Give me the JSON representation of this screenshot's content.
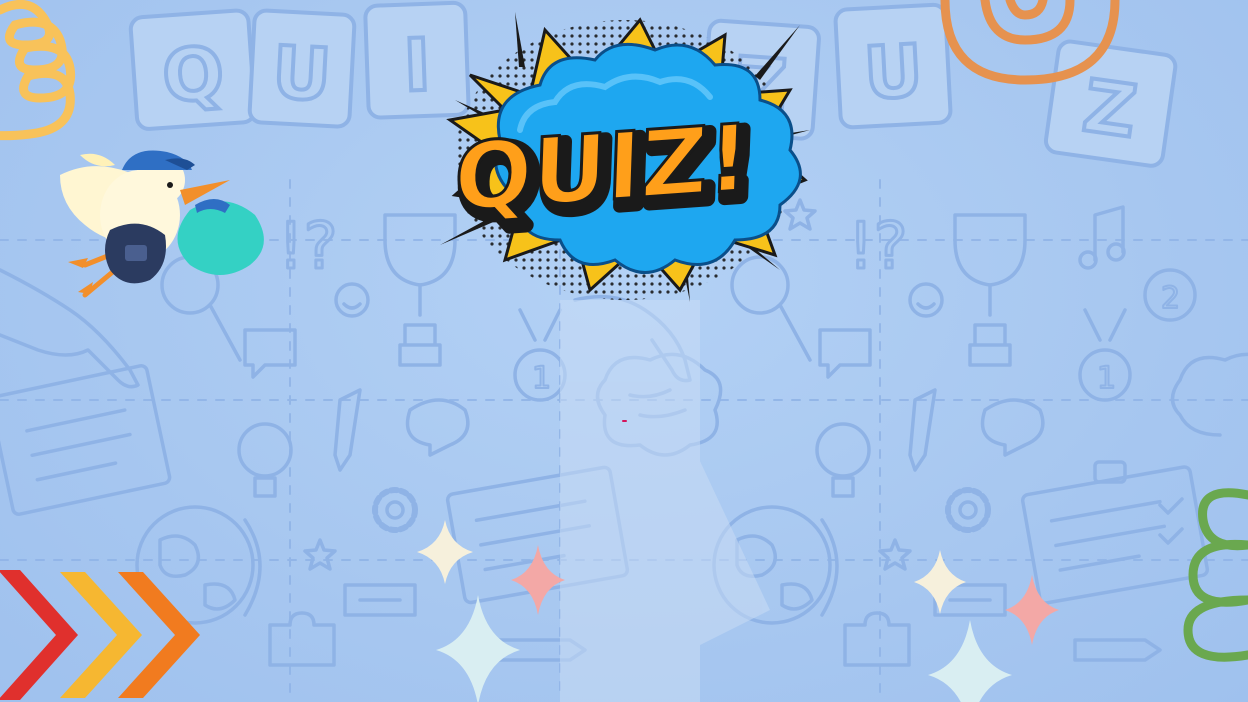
{
  "scene": {
    "title": "QUIZ!",
    "background_letters": [
      "Q",
      "U",
      "I",
      "Z",
      "U",
      "Z"
    ],
    "colors": {
      "background": "#a9c9f1",
      "doodle": "#8fb3e6",
      "burst_yellow": "#f7c21a",
      "cloud_blue": "#1ea7f0",
      "title_orange": "#ff9f1a",
      "title_outline": "#1a1a1a",
      "chevron_red": "#e0302d",
      "chevron_yellow": "#f6b731",
      "chevron_orange": "#f17b1f",
      "swirl_orange": "#e6924f",
      "spring_yellow": "#f8c25a",
      "spring_green": "#6aa84f",
      "sparkle_pink": "#f3a8a6",
      "sparkle_cream": "#f6f0dc",
      "sparkle_mint": "#d9eef2"
    },
    "icons": [
      "question-mark-icon",
      "exclamation-mark-icon",
      "trophy-icon",
      "medal-icon",
      "lightbulb-icon",
      "globe-icon",
      "gear-icon",
      "pencil-icon",
      "brain-icon",
      "music-note-icon",
      "magnifier-icon",
      "puzzle-icon",
      "clipboard-icon",
      "chat-bubble-icon",
      "smiley-icon",
      "star-icon",
      "hand-icon"
    ]
  }
}
